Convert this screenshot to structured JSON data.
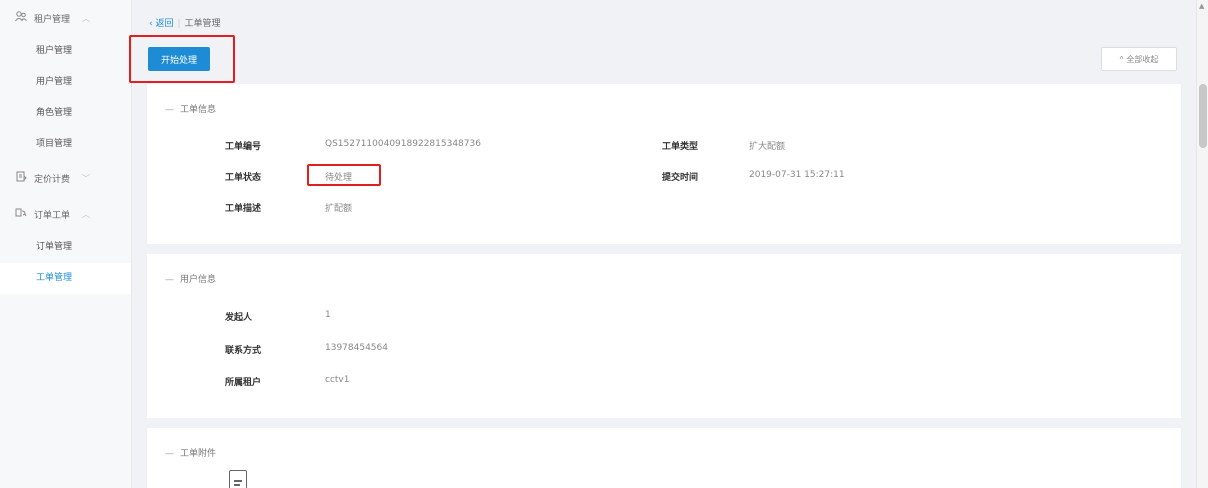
{
  "sidebar": {
    "groups": [
      {
        "icon": "users-icon",
        "label": "租户管理",
        "expanded": true,
        "items": [
          "租户管理",
          "用户管理",
          "角色管理",
          "项目管理"
        ]
      },
      {
        "icon": "billing-icon",
        "label": "定价计费",
        "expanded": false,
        "items": []
      },
      {
        "icon": "order-icon",
        "label": "订单工单",
        "expanded": true,
        "items": [
          "订单管理",
          "工单管理"
        ]
      }
    ],
    "active_item": "工单管理"
  },
  "breadcrumb": {
    "back": "返回",
    "separator": "|",
    "current": "工单管理"
  },
  "toolbar": {
    "start_label": "开始处理",
    "collapse_label": "全部收起"
  },
  "ticket_info": {
    "title": "工单信息",
    "fields": {
      "number_label": "工单编号",
      "number_value": "QS15271100409189228153487​36",
      "type_label": "工单类型",
      "type_value": "扩大配额",
      "status_label": "工单状态",
      "status_value": "待处理",
      "time_label": "提交时间",
      "time_value": "2019-07-31 15:27:11",
      "desc_label": "工单描述",
      "desc_value": "扩配额"
    }
  },
  "user_info": {
    "title": "用户信息",
    "fields": {
      "initiator_label": "发起人",
      "initiator_value": "1",
      "contact_label": "联系方式",
      "contact_value": "13978454564",
      "tenant_label": "所属租户",
      "tenant_value": "cctv1"
    }
  },
  "attachments": {
    "title": "工单附件"
  },
  "colors": {
    "accent": "#1e8cd5",
    "highlight": "#e02020"
  }
}
